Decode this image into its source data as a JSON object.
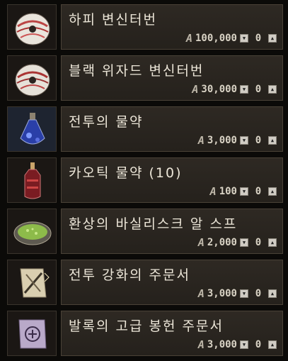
{
  "currency_symbol": "A",
  "items": [
    {
      "name": "하피 변신터번",
      "price": "100,000",
      "quantity": "0",
      "icon": "turban-icon"
    },
    {
      "name": "블랙 위자드 변신터번",
      "price": "30,000",
      "quantity": "0",
      "icon": "turban-icon"
    },
    {
      "name": "전투의 물약",
      "price": "3,000",
      "quantity": "0",
      "icon": "blue-potion-icon"
    },
    {
      "name": "카오틱 물약 (10)",
      "price": "100",
      "quantity": "0",
      "icon": "red-potion-icon"
    },
    {
      "name": "환상의 바실리스크 알 스프",
      "price": "2,000",
      "quantity": "0",
      "icon": "soup-bowl-icon"
    },
    {
      "name": "전투 강화의 주문서",
      "price": "3,000",
      "quantity": "0",
      "icon": "scroll-icon"
    },
    {
      "name": "발록의 고급 봉헌 주문서",
      "price": "3,000",
      "quantity": "0",
      "icon": "purple-scroll-icon"
    }
  ],
  "stepper_glyphs": {
    "down": "▼",
    "up": "▲"
  }
}
